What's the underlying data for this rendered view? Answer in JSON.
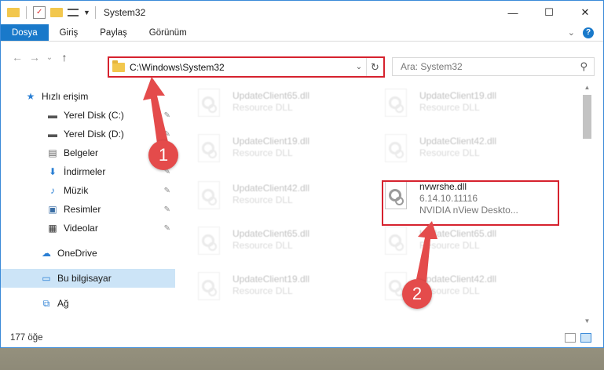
{
  "window": {
    "title": "System32",
    "controls": {
      "minimize": "—",
      "maximize": "☐",
      "close": "✕"
    }
  },
  "ribbon": {
    "tabs": [
      "Dosya",
      "Giriş",
      "Paylaş",
      "Görünüm"
    ],
    "expand_icon": "chevron-down-icon",
    "help_label": "?"
  },
  "nav": {
    "back": "←",
    "forward": "→",
    "recent": "⌄",
    "up": "↑"
  },
  "address": {
    "path": "C:\\Windows\\System32",
    "dropdown": "⌄",
    "refresh": "↻"
  },
  "search": {
    "placeholder": "Ara: System32",
    "icon": "⚲"
  },
  "sidebar": {
    "items": [
      {
        "label": "Hızlı erişim",
        "icon": "★",
        "pinned": false
      },
      {
        "label": "Yerel Disk (C:)",
        "icon": "▬",
        "pinned": true
      },
      {
        "label": "Yerel Disk (D:)",
        "icon": "▬",
        "pinned": true
      },
      {
        "label": "Belgeler",
        "icon": "▤",
        "pinned": true
      },
      {
        "label": "İndirmeler",
        "icon": "⬇",
        "pinned": true
      },
      {
        "label": "Müzik",
        "icon": "♪",
        "pinned": true
      },
      {
        "label": "Resimler",
        "icon": "▣",
        "pinned": true
      },
      {
        "label": "Videolar",
        "icon": "▦",
        "pinned": true
      },
      {
        "label": "OneDrive",
        "icon": "☁",
        "pinned": false
      },
      {
        "label": "Bu bilgisayar",
        "icon": "▭",
        "pinned": false
      },
      {
        "label": "Ağ",
        "icon": "⧉",
        "pinned": false
      }
    ],
    "pin_glyph": "📌"
  },
  "files": [
    {
      "name": "UpdateClient65.dll",
      "desc": "Resource DLL"
    },
    {
      "name": "UpdateClient19.dll",
      "desc": "Resource DLL"
    },
    {
      "name": "UpdateClient19.dll",
      "desc": "Resource DLL"
    },
    {
      "name": "UpdateClient42.dll",
      "desc": "Resource DLL"
    },
    {
      "name": "UpdateClient42.dll",
      "desc": "Resource DLL"
    },
    {
      "name": "nvwrshe.dll",
      "version": "6.14.10.11116",
      "desc": "NVIDIA nView Deskto..."
    },
    {
      "name": "UpdateClient65.dll",
      "desc": "Resource DLL"
    },
    {
      "name": "UpdateClient65.dll",
      "desc": "Resource DLL"
    },
    {
      "name": "UpdateClient19.dll",
      "desc": "Resource DLL"
    },
    {
      "name": "UpdateClient42.dll",
      "desc": "Resource DLL"
    }
  ],
  "status": {
    "count": "177 öğe"
  },
  "callouts": [
    "1",
    "2"
  ],
  "colors": {
    "accent": "#1979ca",
    "highlight": "#d6222e",
    "callout": "#e44b4b"
  }
}
